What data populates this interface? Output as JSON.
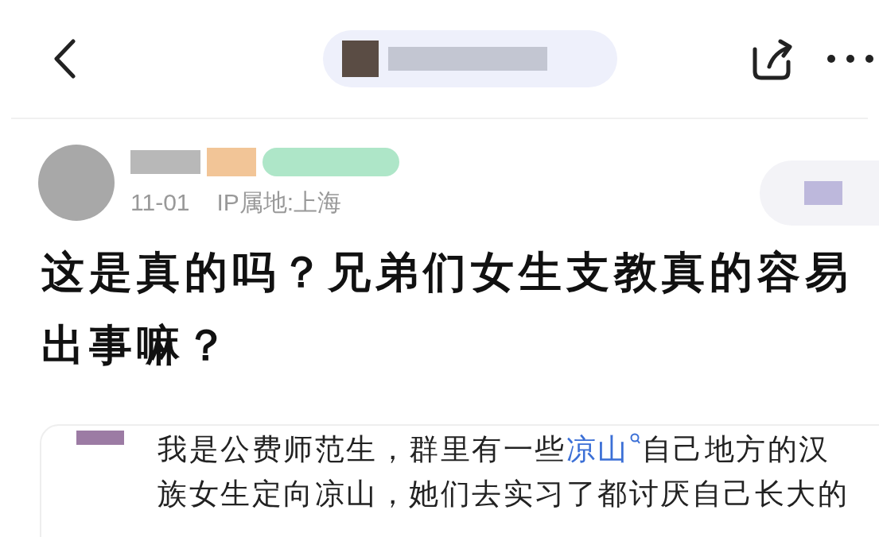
{
  "post": {
    "date": "11-01",
    "ip_location": "IP属地:上海",
    "title": "这是真的吗？兄弟们女生支教真的容易出事嘛？"
  },
  "quote": {
    "text_before": "我是公费师范生，群里有一些",
    "link": "凉山",
    "text_after": "自己地方的汉族女生定向凉山，她们去实习了都讨厌自己长大的"
  }
}
